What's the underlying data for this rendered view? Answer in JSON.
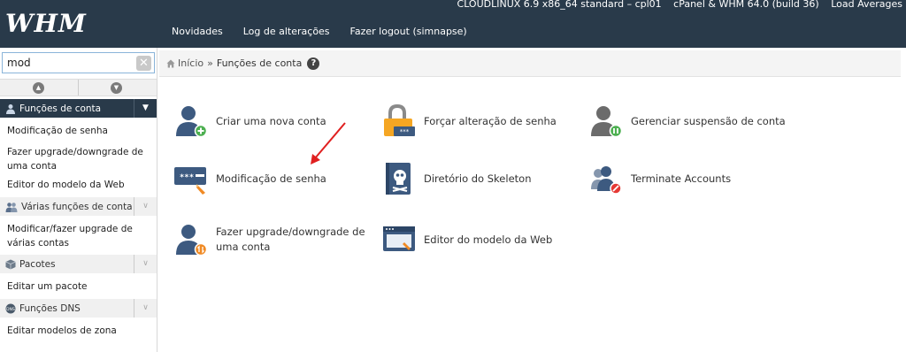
{
  "header": {
    "logo": "WHM",
    "system_info": [
      "CLOUDLINUX 6.9 x86_64 standard – cpl01",
      "cPanel & WHM 64.0 (build 36)",
      "Load Averages"
    ],
    "nav": [
      "Novidades",
      "Log de alterações",
      "Fazer logout (simnapse)"
    ]
  },
  "sidebar": {
    "search_value": "mod",
    "clear_icon": "✕",
    "categories": [
      {
        "label": "Funções de conta",
        "icon": "user-icon",
        "items": [
          "Modificação de senha",
          "Fazer upgrade/downgrade de uma conta",
          "Editor do modelo da Web"
        ]
      },
      {
        "label": "Várias funções de conta",
        "icon": "users-icon",
        "items": [
          "Modificar/fazer upgrade de várias contas"
        ]
      },
      {
        "label": "Pacotes",
        "icon": "package-icon",
        "items": [
          "Editar um pacote"
        ]
      },
      {
        "label": "Funções DNS",
        "icon": "dns-icon",
        "items": [
          "Editar modelos de zona"
        ]
      }
    ]
  },
  "breadcrumb": {
    "home": "Início",
    "separator": "»",
    "current": "Funções de conta",
    "help": "?"
  },
  "features": [
    {
      "label": "Criar uma nova conta",
      "icon": "create-account-icon"
    },
    {
      "label": "Forçar alteração de senha",
      "icon": "force-password-icon"
    },
    {
      "label": "Gerenciar suspensão de conta",
      "icon": "suspend-account-icon"
    },
    {
      "label": "Modificação de senha",
      "icon": "password-modify-icon"
    },
    {
      "label": "Diretório do Skeleton",
      "icon": "skeleton-icon"
    },
    {
      "label": "Terminate Accounts",
      "icon": "terminate-accounts-icon"
    },
    {
      "label": "Fazer upgrade/downgrade de uma conta",
      "icon": "upgrade-downgrade-icon"
    },
    {
      "label": "Editor do modelo da Web",
      "icon": "web-template-icon"
    }
  ],
  "colors": {
    "header_bg": "#293a4a",
    "icon_blue": "#3d5a80",
    "accent_orange": "#f08a24",
    "accent_green": "#4caf50",
    "annotation_arrow": "#e02020"
  }
}
